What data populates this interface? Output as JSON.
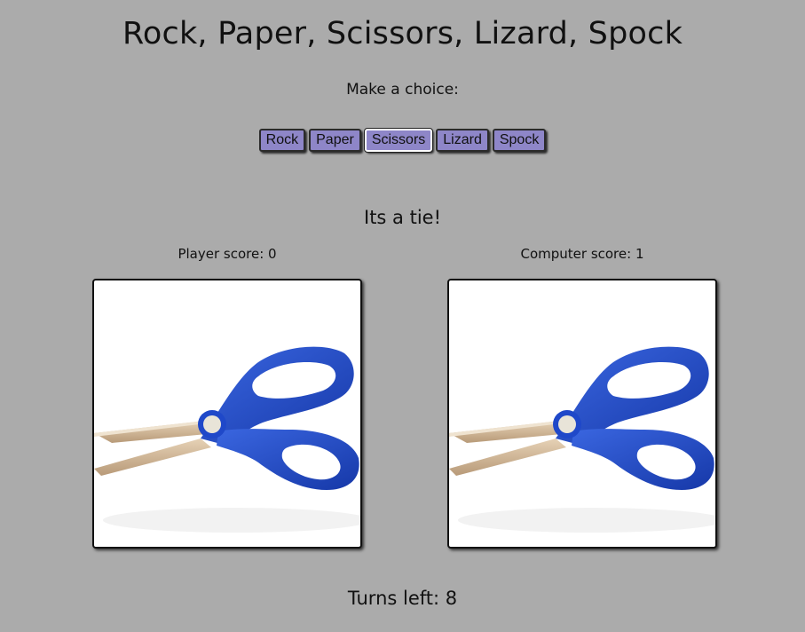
{
  "title": "Rock, Paper, Scissors, Lizard, Spock",
  "prompt": "Make a choice:",
  "choices": [
    {
      "label": "Rock",
      "selected": false
    },
    {
      "label": "Paper",
      "selected": false
    },
    {
      "label": "Scissors",
      "selected": true
    },
    {
      "label": "Lizard",
      "selected": false
    },
    {
      "label": "Spock",
      "selected": false
    }
  ],
  "result": "Its a tie!",
  "player": {
    "score_text": "Player score: 0",
    "choice_image": "scissors-image"
  },
  "computer": {
    "score_text": "Computer score: 1",
    "choice_image": "scissors-image"
  },
  "turns_text": "Turns left: 8",
  "colors": {
    "background": "#ababab",
    "button": "#8e86c8",
    "scissor_handle": "#1f48c9",
    "scissor_blade": "#d2b897"
  }
}
